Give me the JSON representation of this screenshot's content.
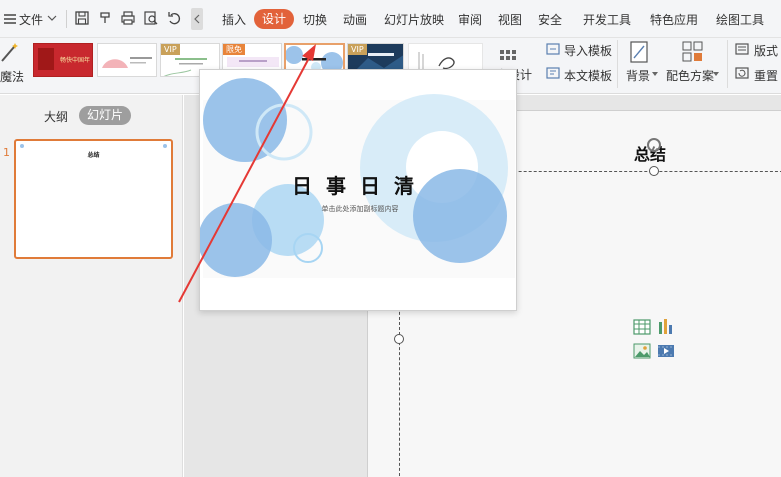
{
  "menubar": {
    "file_label": "文件",
    "tabs": [
      "插入",
      "设计",
      "切换",
      "动画",
      "幻灯片放映",
      "审阅",
      "视图",
      "安全",
      "开发工具",
      "特色应用",
      "绘图工具"
    ],
    "active_tab": "设计"
  },
  "ribbon": {
    "magic_label": "魔法",
    "badges": {
      "vip1": "VIP",
      "free": "限免",
      "vip2": "VIP"
    },
    "thumb1_text": "畅快中国年",
    "thumb_more_label": "更多设计",
    "import_template_label": "导入模板",
    "text_template_label": "本文模板",
    "background_label": "背景",
    "color_scheme_label": "配色方案",
    "layout_label": "版式",
    "reset_label": "重置"
  },
  "left_panel": {
    "outline_tab": "大纲",
    "slides_tab": "幻灯片",
    "slide_number": "1",
    "slide_title": "总结"
  },
  "popup": {
    "title": "日事日清",
    "subtitle": "单击此处添加副标题内容"
  },
  "slide": {
    "title": "总结"
  },
  "colors": {
    "accent": "#e2623a",
    "selection": "#e07b39",
    "arrow": "#e53935",
    "bubble_blue": "#8ab8e6",
    "bubble_light": "#cfe8f7"
  }
}
